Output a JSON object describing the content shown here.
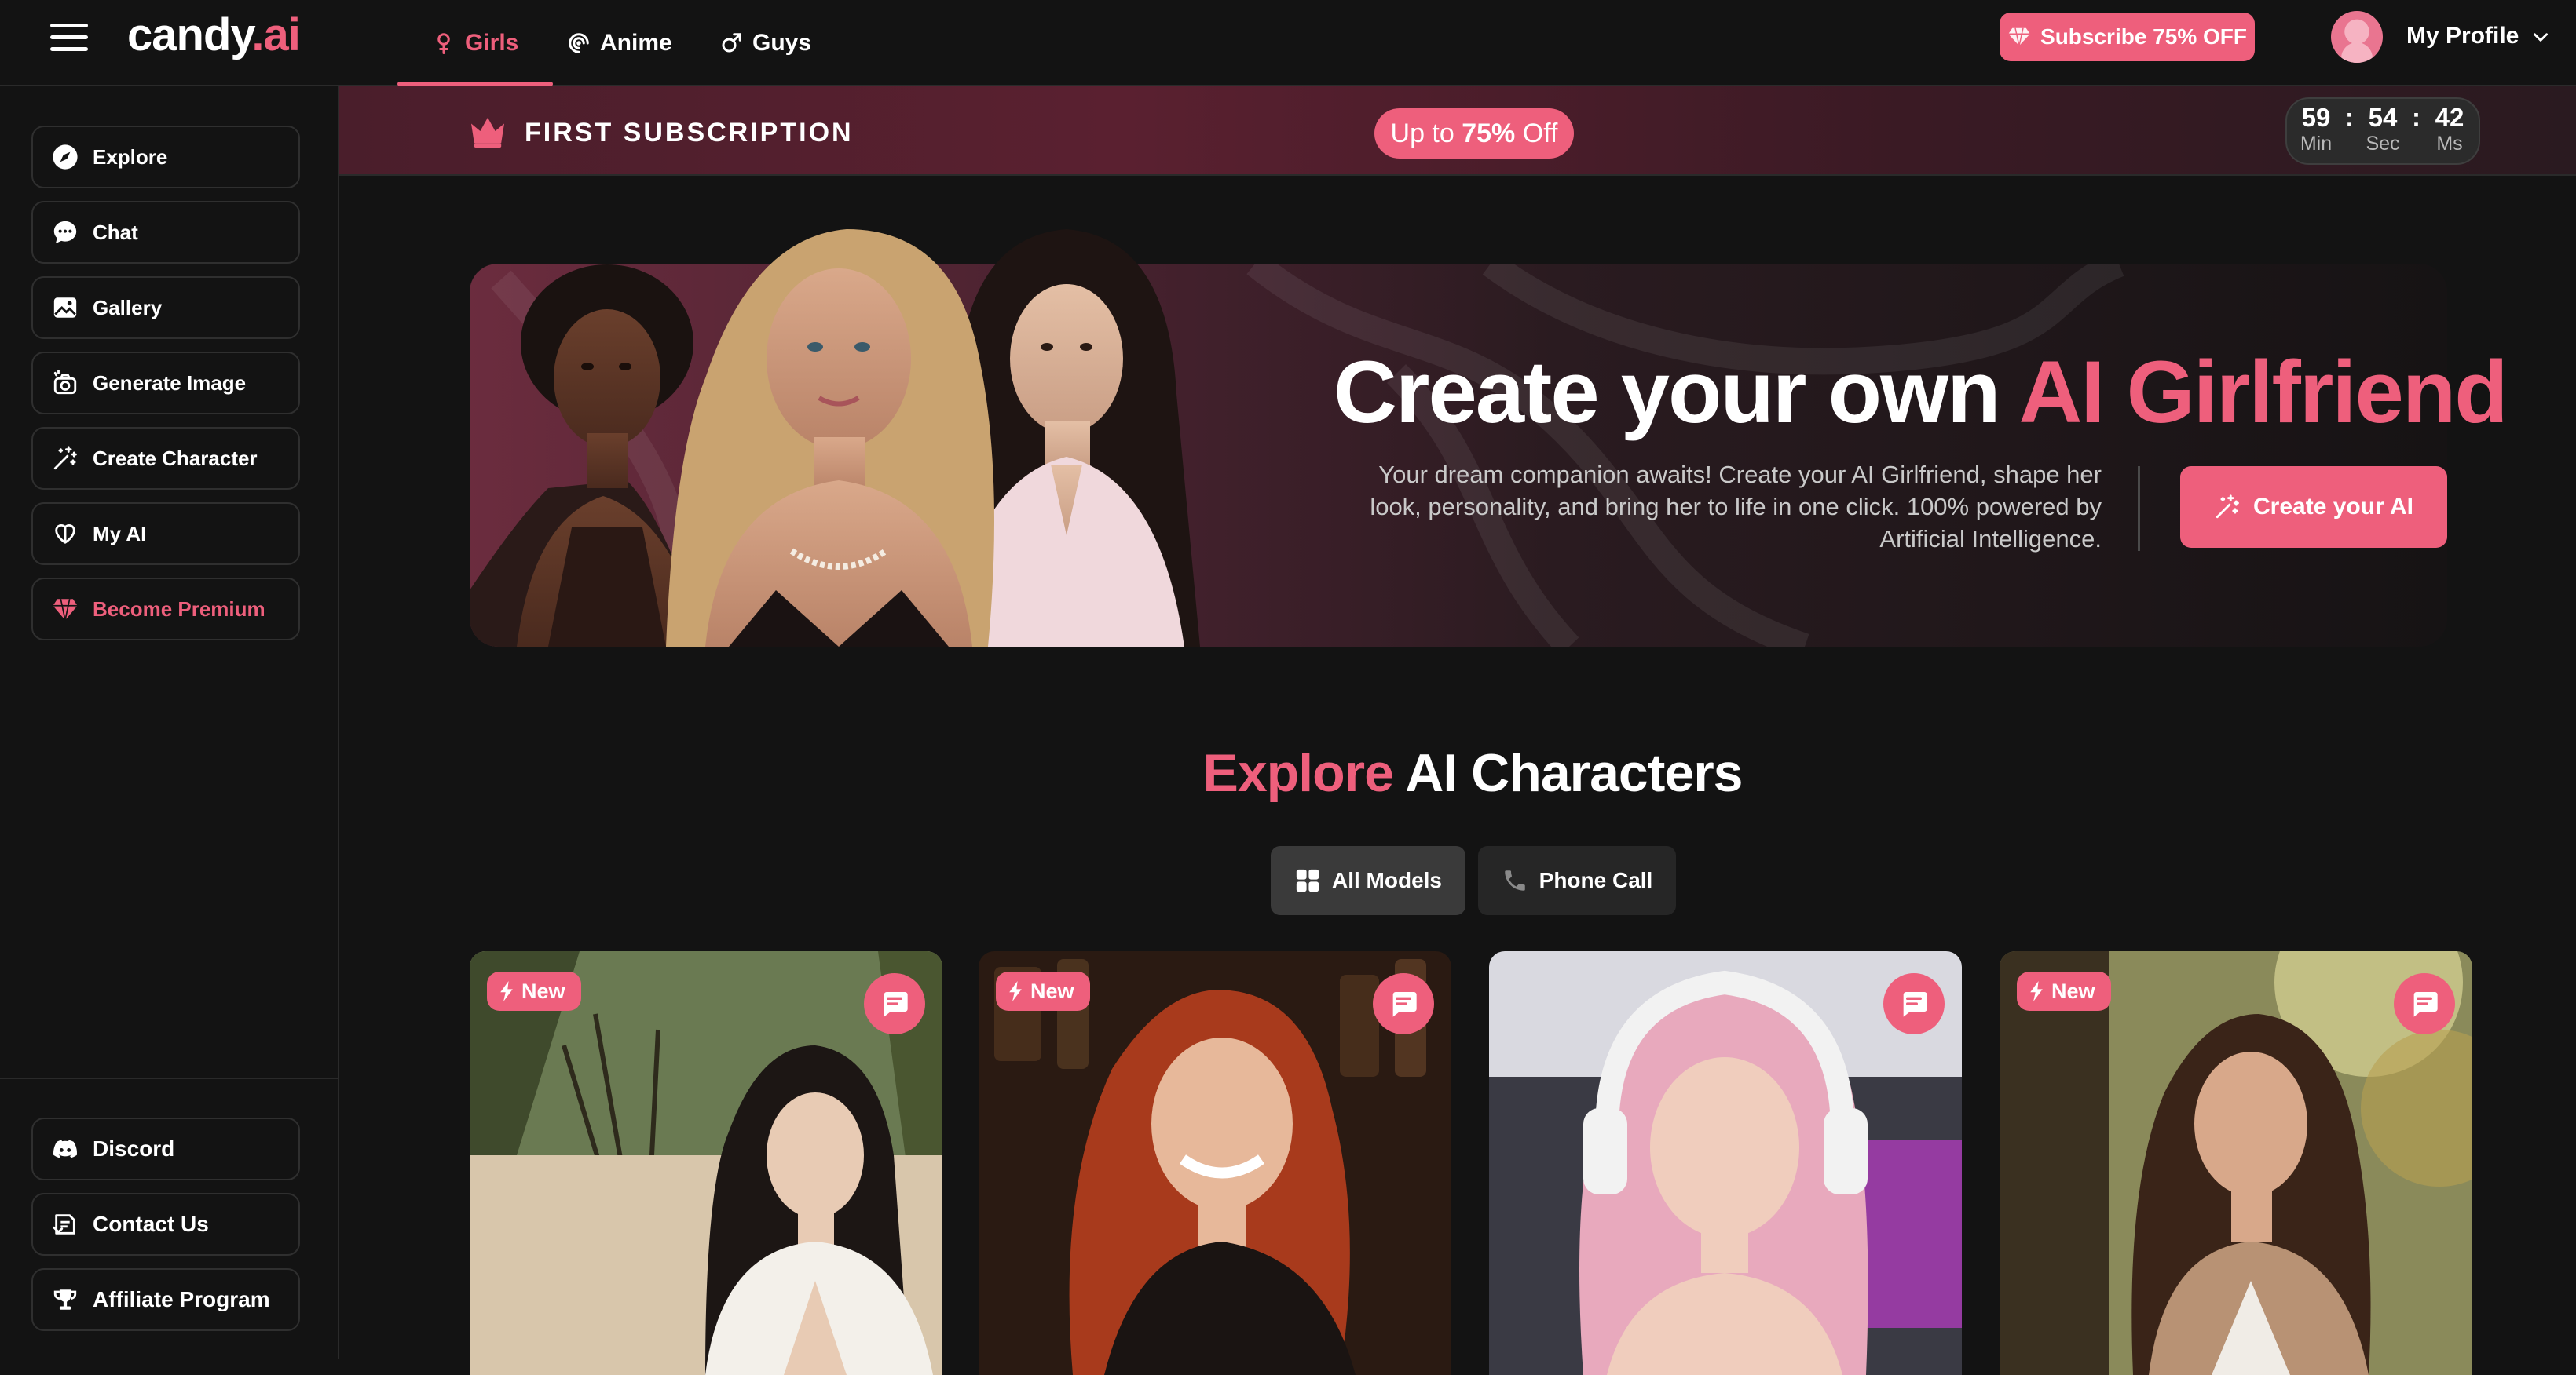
{
  "brand": {
    "logo_main": "candy",
    "logo_accent": ".ai"
  },
  "topnav": {
    "tabs": [
      {
        "label": "Girls",
        "icon": "female-icon",
        "active": true
      },
      {
        "label": "Anime",
        "icon": "swirl-icon",
        "active": false
      },
      {
        "label": "Guys",
        "icon": "male-icon",
        "active": false
      }
    ],
    "subscribe_label": "Subscribe 75% OFF",
    "profile_label": "My Profile"
  },
  "sidebar": {
    "items": [
      {
        "label": "Explore",
        "icon": "compass-icon"
      },
      {
        "label": "Chat",
        "icon": "chat-icon"
      },
      {
        "label": "Gallery",
        "icon": "image-icon"
      },
      {
        "label": "Generate Image",
        "icon": "camera-sparkle-icon"
      },
      {
        "label": "Create Character",
        "icon": "magic-wand-icon"
      },
      {
        "label": "My AI",
        "icon": "heart-hands-icon"
      },
      {
        "label": "Become Premium",
        "icon": "diamond-icon"
      }
    ],
    "bottom_items": [
      {
        "label": "Discord",
        "icon": "discord-icon"
      },
      {
        "label": "Contact Us",
        "icon": "contact-icon"
      },
      {
        "label": "Affiliate Program",
        "icon": "trophy-icon"
      }
    ]
  },
  "banner": {
    "title": "FIRST SUBSCRIPTION",
    "pill_prefix": "Up to ",
    "pill_value": "75%",
    "pill_suffix": " Off",
    "timer": [
      {
        "value": "59",
        "label": "Min"
      },
      {
        "value": "54",
        "label": "Sec"
      },
      {
        "value": "42",
        "label": "Ms"
      }
    ]
  },
  "hero": {
    "title_main": "Create your own ",
    "title_accent": "AI Girlfriend",
    "description": "Your dream companion awaits! Create your AI Girlfriend, shape her look, personality, and bring her to life in one click. 100% powered by Artificial Intelligence.",
    "cta_label": "Create your AI"
  },
  "explore": {
    "title_accent": "Explore",
    "title_main": " AI Characters",
    "filters": [
      {
        "label": "All Models",
        "icon": "grid-icon",
        "selected": true
      },
      {
        "label": "Phone Call",
        "icon": "phone-icon",
        "selected": false
      }
    ],
    "cards": [
      {
        "badge": "New",
        "has_badge": true
      },
      {
        "badge": "New",
        "has_badge": true
      },
      {
        "badge": "",
        "has_badge": false
      },
      {
        "badge": "New",
        "has_badge": true
      }
    ]
  },
  "colors": {
    "accent": "#ee5f7c",
    "background": "#131313",
    "border": "#2f2f2f"
  }
}
